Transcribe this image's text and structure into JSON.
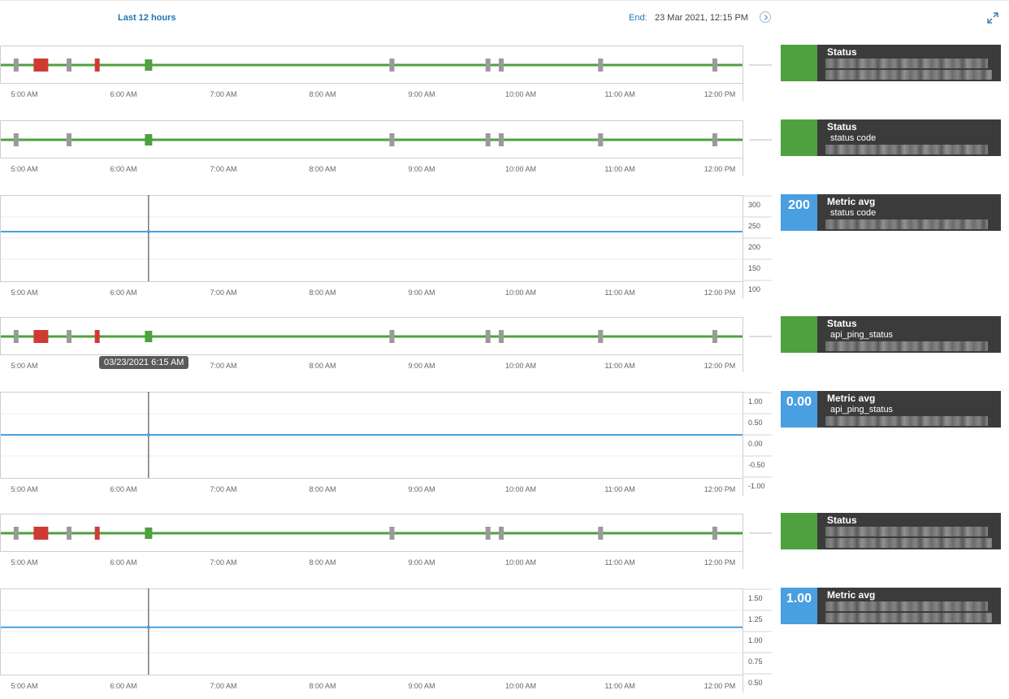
{
  "header": {
    "range_label": "Last 12 hours",
    "end_label": "End:",
    "end_value": "23 Mar 2021, 12:15 PM"
  },
  "time_axis": [
    "5:00 AM",
    "6:00 AM",
    "7:00 AM",
    "8:00 AM",
    "9:00 AM",
    "10:00 AM",
    "11:00 AM",
    "12:00 PM"
  ],
  "crosshair_tooltip": "03/23/2021 6:15 AM",
  "colors": {
    "ok": "#4ea13e",
    "critical": "#cf3b33",
    "no_data": "#9a9a9a",
    "metric_line": "#4a9fe0",
    "tile_bg": "#3b3b3b"
  },
  "panels": [
    {
      "type": "status",
      "events": [
        {
          "time": "4:55 AM",
          "state": "no_data"
        },
        {
          "time": "5:10 AM",
          "state": "critical",
          "duration_min": 8
        },
        {
          "time": "5:27 AM",
          "state": "no_data"
        },
        {
          "time": "5:44 AM",
          "state": "critical"
        },
        {
          "time": "6:15 AM",
          "state": "ok"
        },
        {
          "time": "8:42 AM",
          "state": "no_data"
        },
        {
          "time": "9:40 AM",
          "state": "no_data"
        },
        {
          "time": "9:48 AM",
          "state": "no_data"
        },
        {
          "time": "10:48 AM",
          "state": "no_data"
        },
        {
          "time": "11:57 AM",
          "state": "no_data"
        }
      ],
      "tile": {
        "title": "Status",
        "subtitle": "",
        "value": "",
        "kind": "status"
      }
    },
    {
      "type": "status",
      "events": [
        {
          "time": "4:55 AM",
          "state": "no_data"
        },
        {
          "time": "5:27 AM",
          "state": "no_data"
        },
        {
          "time": "6:15 AM",
          "state": "ok"
        },
        {
          "time": "8:42 AM",
          "state": "no_data"
        },
        {
          "time": "9:40 AM",
          "state": "no_data"
        },
        {
          "time": "9:48 AM",
          "state": "no_data"
        },
        {
          "time": "10:48 AM",
          "state": "no_data"
        },
        {
          "time": "11:57 AM",
          "state": "no_data"
        }
      ],
      "tile": {
        "title": "Status",
        "subtitle": "status code",
        "value": "",
        "kind": "status"
      }
    },
    {
      "type": "metric",
      "y_ticks": [
        "300",
        "250",
        "200",
        "150",
        "100"
      ],
      "ylim": [
        100,
        300
      ],
      "value": 215,
      "tile": {
        "title": "Metric avg",
        "subtitle": "status code",
        "value": "200",
        "kind": "metric"
      }
    },
    {
      "type": "status",
      "events": [
        {
          "time": "4:55 AM",
          "state": "no_data"
        },
        {
          "time": "5:10 AM",
          "state": "critical",
          "duration_min": 8
        },
        {
          "time": "5:27 AM",
          "state": "no_data"
        },
        {
          "time": "5:44 AM",
          "state": "critical"
        },
        {
          "time": "6:15 AM",
          "state": "ok"
        },
        {
          "time": "8:42 AM",
          "state": "no_data"
        },
        {
          "time": "9:40 AM",
          "state": "no_data"
        },
        {
          "time": "9:48 AM",
          "state": "no_data"
        },
        {
          "time": "10:48 AM",
          "state": "no_data"
        },
        {
          "time": "11:57 AM",
          "state": "no_data"
        }
      ],
      "tile": {
        "title": "Status",
        "subtitle": "api_ping_status",
        "value": "",
        "kind": "status"
      }
    },
    {
      "type": "metric",
      "y_ticks": [
        "1.00",
        "0.50",
        "0.00",
        "-0.50",
        "-1.00"
      ],
      "ylim": [
        -1,
        1
      ],
      "value": 0,
      "tile": {
        "title": "Metric avg",
        "subtitle": "api_ping_status",
        "value": "0.00",
        "kind": "metric"
      }
    },
    {
      "type": "status",
      "events": [
        {
          "time": "4:55 AM",
          "state": "no_data"
        },
        {
          "time": "5:10 AM",
          "state": "critical",
          "duration_min": 8
        },
        {
          "time": "5:27 AM",
          "state": "no_data"
        },
        {
          "time": "5:44 AM",
          "state": "critical"
        },
        {
          "time": "6:15 AM",
          "state": "ok"
        },
        {
          "time": "8:42 AM",
          "state": "no_data"
        },
        {
          "time": "9:40 AM",
          "state": "no_data"
        },
        {
          "time": "9:48 AM",
          "state": "no_data"
        },
        {
          "time": "10:48 AM",
          "state": "no_data"
        },
        {
          "time": "11:57 AM",
          "state": "no_data"
        }
      ],
      "tile": {
        "title": "Status",
        "subtitle": "",
        "value": "",
        "kind": "status"
      }
    },
    {
      "type": "metric",
      "y_ticks": [
        "1.50",
        "1.25",
        "1.00",
        "0.75",
        "0.50"
      ],
      "ylim": [
        0.5,
        1.5
      ],
      "value": 1.05,
      "tile": {
        "title": "Metric avg",
        "subtitle": "",
        "value": "1.00",
        "kind": "metric"
      }
    }
  ]
}
